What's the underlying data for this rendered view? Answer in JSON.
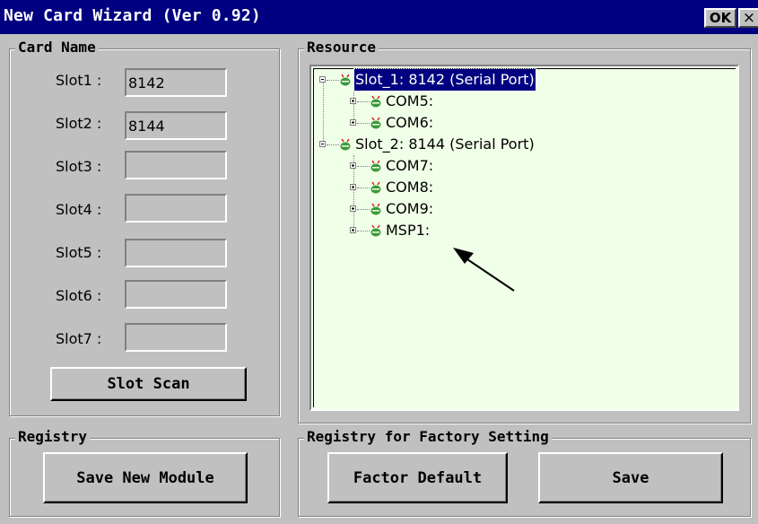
{
  "window": {
    "title": "New Card Wizard (Ver 0.92)",
    "ok_label": "OK",
    "close_label": "×"
  },
  "card_name": {
    "group_label": "Card Name",
    "slots": [
      {
        "label": "Slot1 :",
        "value": "8142"
      },
      {
        "label": "Slot2 :",
        "value": "8144"
      },
      {
        "label": "Slot3 :",
        "value": ""
      },
      {
        "label": "Slot4 :",
        "value": ""
      },
      {
        "label": "Slot5 :",
        "value": ""
      },
      {
        "label": "Slot6 :",
        "value": ""
      },
      {
        "label": "Slot7 :",
        "value": ""
      }
    ],
    "scan_button": "Slot Scan"
  },
  "resource": {
    "group_label": "Resource",
    "tree": [
      {
        "text": "Slot_1: 8142 (Serial Port)",
        "level": 0,
        "selected": true
      },
      {
        "text": "COM5:",
        "level": 1,
        "selected": false
      },
      {
        "text": "COM6:",
        "level": 1,
        "selected": false
      },
      {
        "text": "Slot_2: 8144 (Serial Port)",
        "level": 0,
        "selected": false
      },
      {
        "text": "COM7:",
        "level": 1,
        "selected": false
      },
      {
        "text": "COM8:",
        "level": 1,
        "selected": false
      },
      {
        "text": "COM9:",
        "level": 1,
        "selected": false
      },
      {
        "text": "MSP1:",
        "level": 1,
        "selected": false
      }
    ],
    "icon": "device-node-icon",
    "annotation": "arrow-pointer-annotation"
  },
  "registry": {
    "group_label": "Registry",
    "save_new_module": "Save New Module"
  },
  "factory": {
    "group_label": "Registry for Factory Setting",
    "factor_default": "Factor Default",
    "save": "Save"
  },
  "colors": {
    "titlebar": "#000080",
    "face": "#c0c0c0",
    "tree_bg": "#f0ffe8",
    "selection": "#000080",
    "icon_green": "#3a9a3a",
    "icon_red": "#cc2222"
  }
}
